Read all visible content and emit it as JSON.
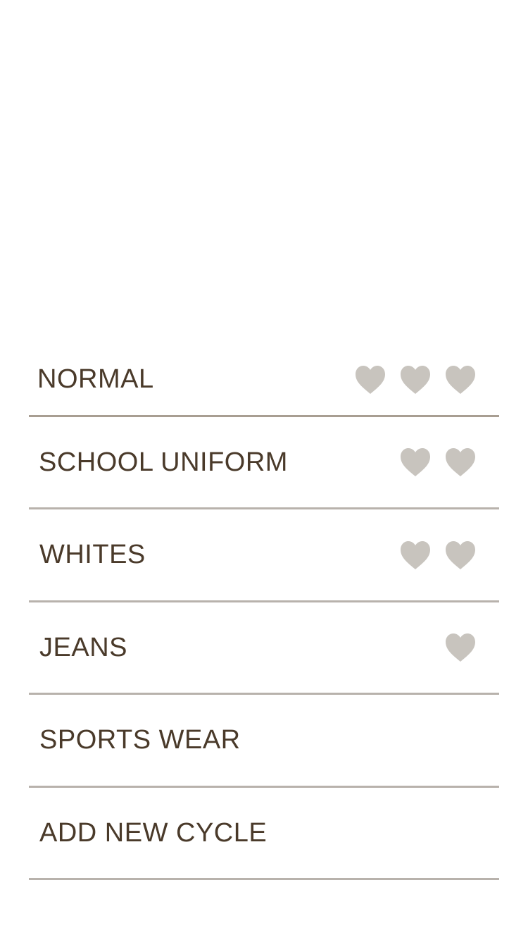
{
  "colors": {
    "text": "#4a3a2a",
    "heart": "#c8c4be",
    "divider": "#b8b2ac"
  },
  "cycles": [
    {
      "label": "NORMAL",
      "hearts": 3
    },
    {
      "label": "SCHOOL UNIFORM",
      "hearts": 2
    },
    {
      "label": "WHITES",
      "hearts": 2
    },
    {
      "label": "JEANS",
      "hearts": 1
    },
    {
      "label": "SPORTS WEAR",
      "hearts": 0
    },
    {
      "label": "ADD NEW CYCLE",
      "hearts": 0
    }
  ],
  "icons": {
    "rating": "heart-icon"
  }
}
